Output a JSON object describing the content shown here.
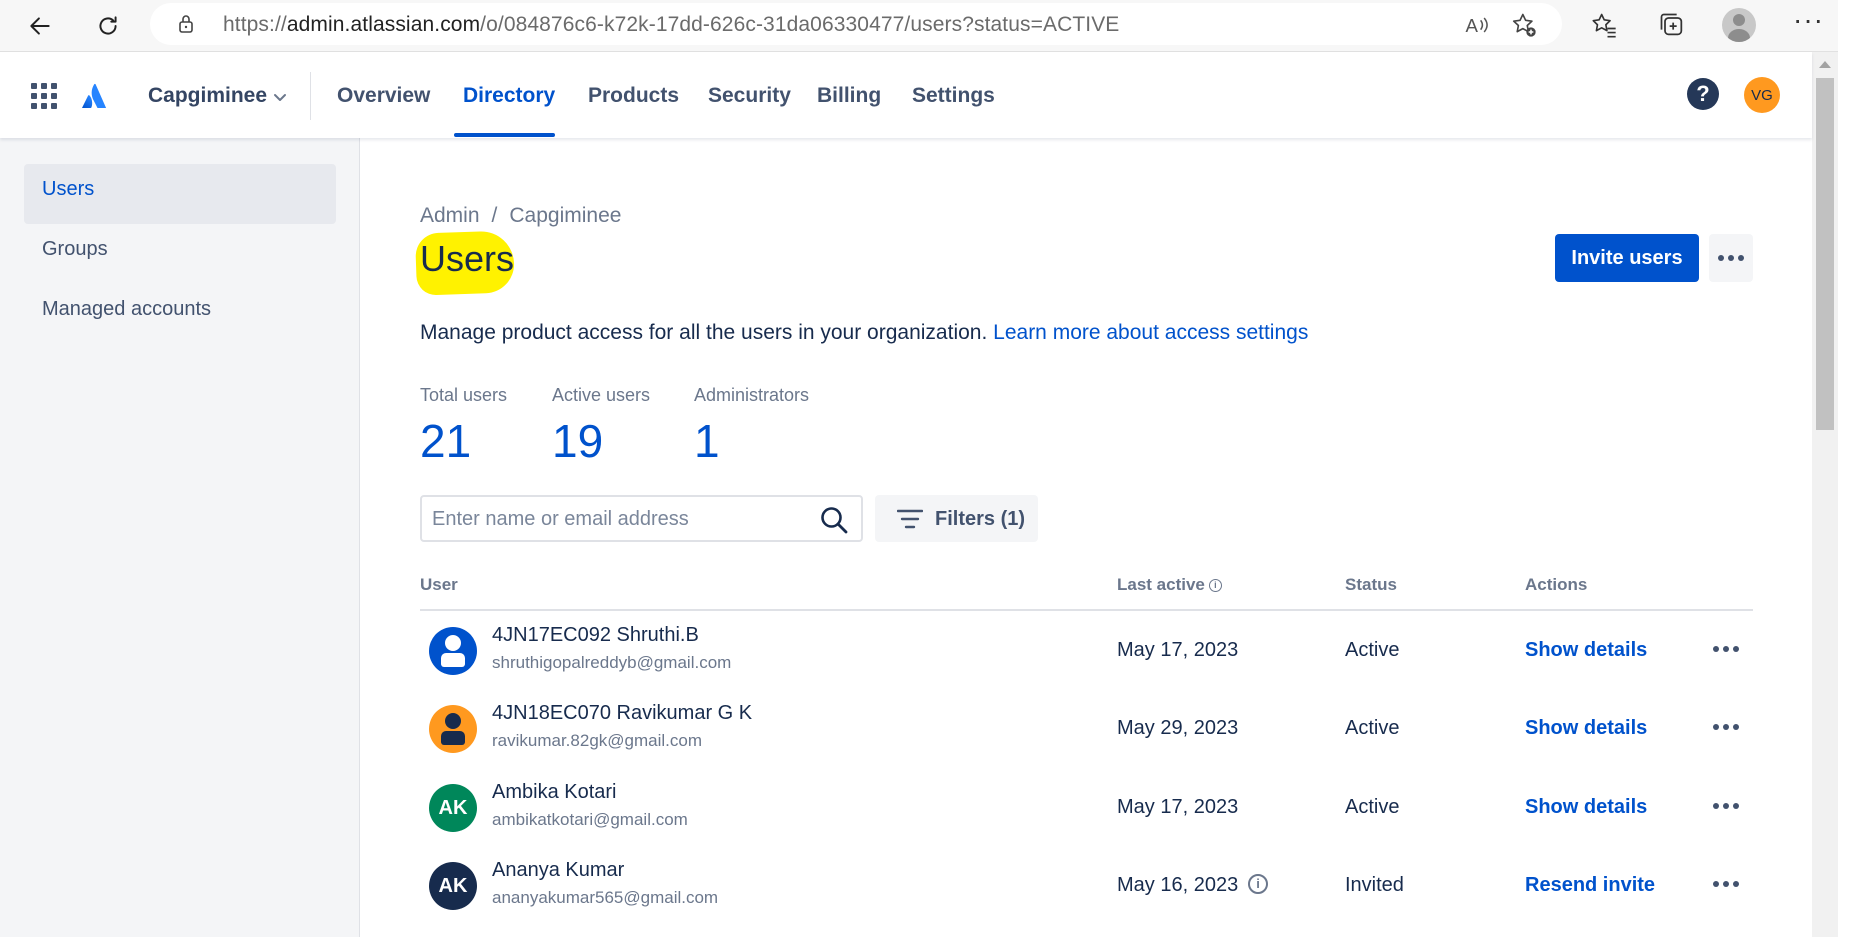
{
  "browser": {
    "url_prefix": "https://",
    "url_domain": "admin.atlassian.com",
    "url_path": "/o/084876c6-k72k-17dd-626c-31da06330477/users?status=ACTIVE"
  },
  "topnav": {
    "org_name": "Capgiminee",
    "tabs": [
      "Overview",
      "Directory",
      "Products",
      "Security",
      "Billing",
      "Settings"
    ],
    "active_tab": "Directory",
    "help_label": "?",
    "user_initials": "VG"
  },
  "sidebar": {
    "items": [
      "Users",
      "Groups",
      "Managed accounts"
    ],
    "active_item": "Users"
  },
  "main": {
    "breadcrumb": [
      "Admin",
      "Capgiminee"
    ],
    "breadcrumb_separator": "/",
    "title": "Users",
    "invite_button": "Invite users",
    "description": "Manage product access for all the users in your organization.",
    "description_link": "Learn more about access settings",
    "stats": [
      {
        "label": "Total users",
        "value": "21"
      },
      {
        "label": "Active users",
        "value": "19"
      },
      {
        "label": "Administrators",
        "value": "1"
      }
    ],
    "search_placeholder": "Enter name or email address",
    "filters_label": "Filters (1)"
  },
  "table": {
    "headers": [
      "User",
      "Last active",
      "Status",
      "Actions"
    ],
    "rows": [
      {
        "name": "4JN17EC092 Shruthi.B",
        "email": "shruthigopalreddyb@gmail.com",
        "last_active": "May 17, 2023",
        "status": "Active",
        "action": "Show details",
        "avatar": {
          "type": "person",
          "bg": "#0052cc",
          "fig": "#ffffff"
        }
      },
      {
        "name": "4JN18EC070 Ravikumar G K",
        "email": "ravikumar.82gk@gmail.com",
        "last_active": "May 29, 2023",
        "status": "Active",
        "action": "Show details",
        "avatar": {
          "type": "person",
          "bg": "#ff991f",
          "fig": "#172b4d"
        }
      },
      {
        "name": "Ambika Kotari",
        "email": "ambikatkotari@gmail.com",
        "last_active": "May 17, 2023",
        "status": "Active",
        "action": "Show details",
        "avatar": {
          "type": "initials",
          "initials": "AK",
          "bg": "#00875a"
        }
      },
      {
        "name": "Ananya Kumar",
        "email": "ananyakumar565@gmail.com",
        "last_active": "May 16, 2023",
        "status": "Invited",
        "action": "Resend invite",
        "avatar": {
          "type": "initials",
          "initials": "AK",
          "bg": "#172b4d"
        },
        "info_icon": true
      }
    ]
  },
  "colors": {
    "brand": "#0052cc",
    "highlight": "#fff200",
    "text": "#172b4d",
    "subtle": "#6b778c"
  }
}
